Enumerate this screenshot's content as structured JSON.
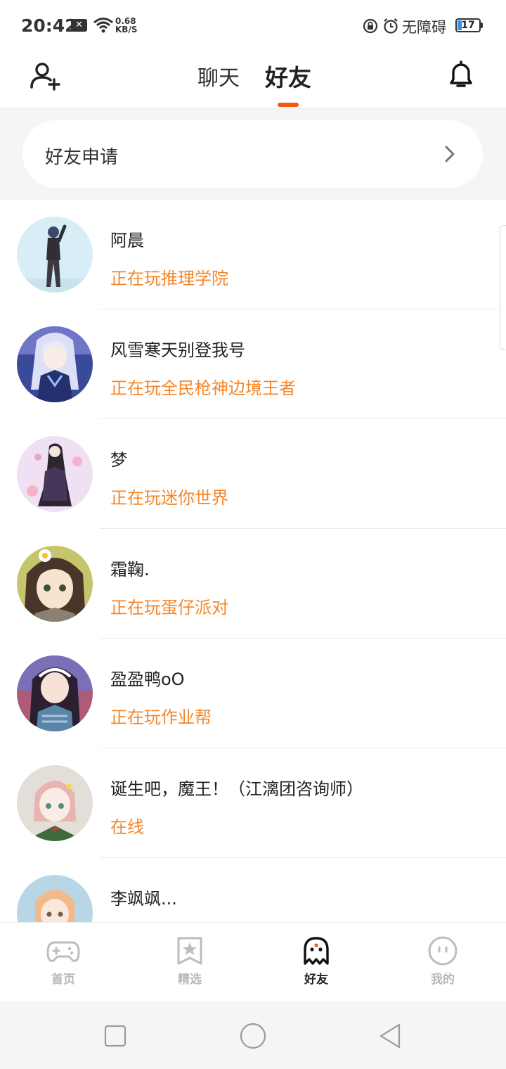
{
  "status_bar": {
    "time": "20:42",
    "notif_badge": "✕",
    "speed_value": "0.68",
    "speed_unit": "KB/S",
    "accessibility_label": "无障碍",
    "battery": "17"
  },
  "header": {
    "tabs": [
      {
        "label": "聊天",
        "active": false
      },
      {
        "label": "好友",
        "active": true
      }
    ],
    "left_icon": "add-friend-icon",
    "right_icon": "bell-icon",
    "accent_color": "#f25a14"
  },
  "friend_request": {
    "label": "好友申请"
  },
  "friends": [
    {
      "name": "阿晨",
      "status": "正在玩推理学院"
    },
    {
      "name": "风雪寒天别登我号",
      "status": "正在玩全民枪神边境王者"
    },
    {
      "name": "梦",
      "status": "正在玩迷你世界"
    },
    {
      "name": "霜鞠.",
      "status": "正在玩蛋仔派对"
    },
    {
      "name": "盈盈鸭oO",
      "status": "正在玩作业帮"
    },
    {
      "name": "诞生吧，魔王！（江漓团咨询师）",
      "status": "在线"
    },
    {
      "name": "李飒飒...",
      "status": ""
    }
  ],
  "status_color": "#f5862a",
  "bottom_nav": {
    "items": [
      {
        "label": "首页",
        "icon": "gamepad-icon",
        "active": false
      },
      {
        "label": "精选",
        "icon": "star-bookmark-icon",
        "active": false
      },
      {
        "label": "好友",
        "icon": "ghost-icon",
        "active": true
      },
      {
        "label": "我的",
        "icon": "face-icon",
        "active": false
      }
    ]
  },
  "system_nav": {
    "buttons": [
      "recents-icon",
      "home-icon",
      "back-icon"
    ]
  }
}
